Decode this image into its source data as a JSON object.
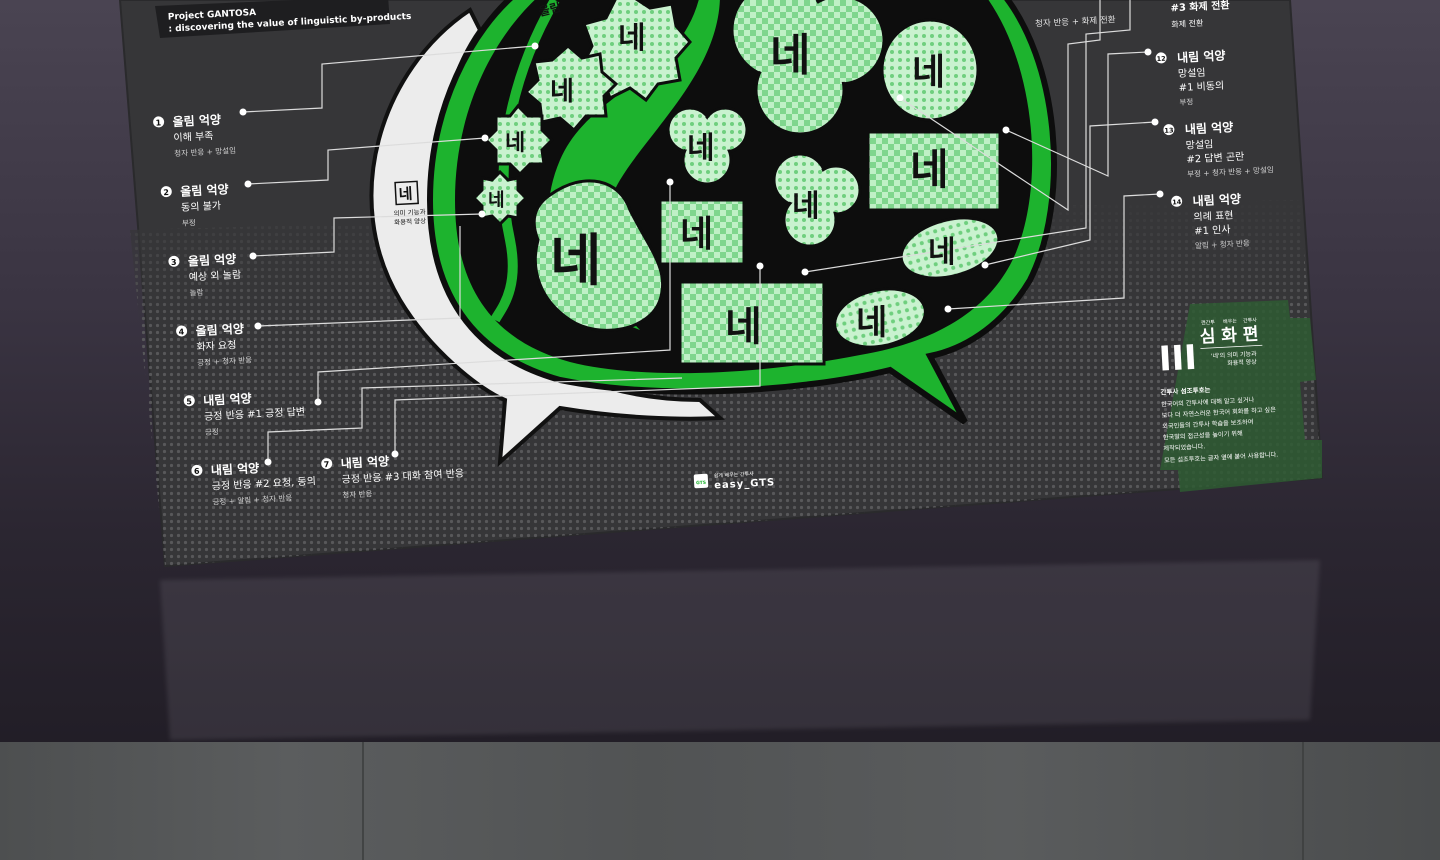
{
  "project_title": "Project GANTOSA",
  "project_subtitle": ": discovering the value of linguistic by-products",
  "center_label": "네",
  "center_caption_line1": "의미 기능과",
  "center_caption_line2": "화용적 양상",
  "top_partial_label": "올림",
  "left_items": [
    {
      "num": "1",
      "title": "올림 억양",
      "sub": "이해 부족",
      "note": "청자 반응 + 망설임"
    },
    {
      "num": "2",
      "title": "올림 억양",
      "sub": "동의 불가",
      "note": "부정"
    },
    {
      "num": "3",
      "title": "올림 억양",
      "sub": "예상 외 놀람",
      "note": "놀람"
    },
    {
      "num": "4",
      "title": "올림 억양",
      "sub": "화자 요청",
      "note": "긍정 + 청자 반응"
    },
    {
      "num": "5",
      "title": "내림 억양",
      "sub": "긍정 반응 #1 긍정 답변",
      "note": "긍정"
    },
    {
      "num": "6",
      "title": "내림 억양",
      "sub": "긍정 반응 #2 요청, 동의",
      "note": "긍정 + 알림 + 청자 반응"
    },
    {
      "num": "7",
      "title": "내림 억양",
      "sub": "긍정 반응 #3 대화 참여 반응",
      "note": "청자 반응"
    }
  ],
  "right_items": [
    {
      "num": "",
      "title": "",
      "sub": "",
      "note": "청자 반응 + 화제 전환"
    },
    {
      "num": "",
      "title": "",
      "sub": "#3 화제 전환",
      "note": "화제 전환"
    },
    {
      "num": "12",
      "title": "내림 억양",
      "sub": "망설임",
      "sub2": "#1 비동의",
      "note": "부정"
    },
    {
      "num": "13",
      "title": "내림 억양",
      "sub": "망설임",
      "sub2": "#2 답변 곤란",
      "note": "부정 + 청자 반응 + 망설임"
    },
    {
      "num": "14",
      "title": "내림 억양",
      "sub": "의례 표현",
      "sub2": "#1 인사",
      "note": "알림 + 청자 반응"
    }
  ],
  "series_block": {
    "roman": "III",
    "kicker1": "깬간투",
    "kicker2": "배우는",
    "kicker3": "간투사",
    "title": "심 화 편",
    "caption1": "'네'의 의미 기능과",
    "caption2": "화용적 양상"
  },
  "description_lines": [
    "간투사 섬조투호는",
    "한국어의 간투사에 대해 알고 싶거나",
    "보다 더 자연스러운 한국어 회화를 하고 싶은",
    "외국인들의 간투사 학습을 보조하여",
    "한국말의 접근성을 높이기 위해",
    "제작되었습니다.",
    "모든 섬조투호는 글자 옆에 붙어 사용합니다."
  ],
  "brand_small": "쉽게 배우는 간투사",
  "brand_name": "easy_GTS",
  "brand_badge": "GTS",
  "bubble_glyph": "네",
  "colors": {
    "poster_bg": "#363638",
    "green": "#1db32e",
    "green_light": "#a6e8b0",
    "dark": "#0d0d0d",
    "white_bubble": "#e9e9e9",
    "accent_block": "#2e5a32"
  }
}
